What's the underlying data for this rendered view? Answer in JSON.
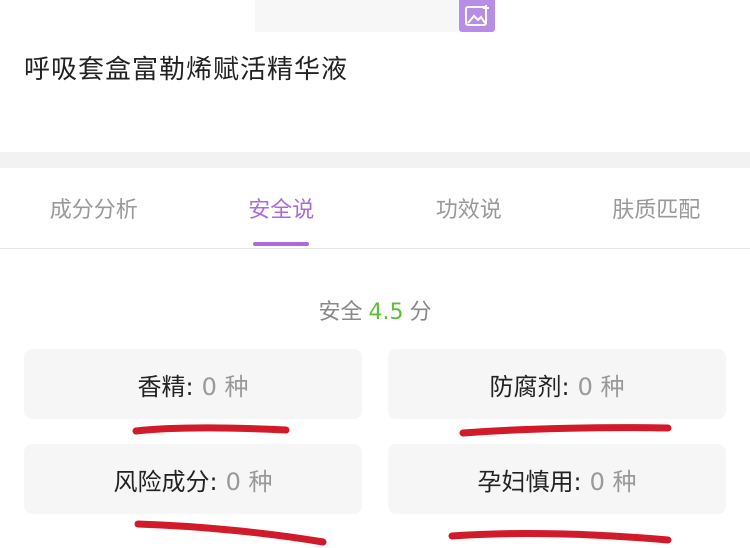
{
  "product": {
    "title": "呼吸套盒富勒烯赋活精华液"
  },
  "tabs": [
    {
      "label": "成分分析"
    },
    {
      "label": "安全说"
    },
    {
      "label": "功效说"
    },
    {
      "label": "肤质匹配"
    }
  ],
  "active_tab": "安全说",
  "safety": {
    "prefix": "安全",
    "score": "4.5",
    "suffix": "分"
  },
  "cards": [
    {
      "label": "香精:",
      "count": "0 种"
    },
    {
      "label": "防腐剂:",
      "count": "0 种"
    },
    {
      "label": "风险成分:",
      "count": "0 种"
    },
    {
      "label": "孕妇慎用:",
      "count": "0 种"
    }
  ],
  "colors": {
    "accent": "#a86ce0",
    "score_green": "#5bbf3a",
    "marker_red": "#d11a2a"
  },
  "icons": {
    "image_upload": "image-add-icon"
  }
}
